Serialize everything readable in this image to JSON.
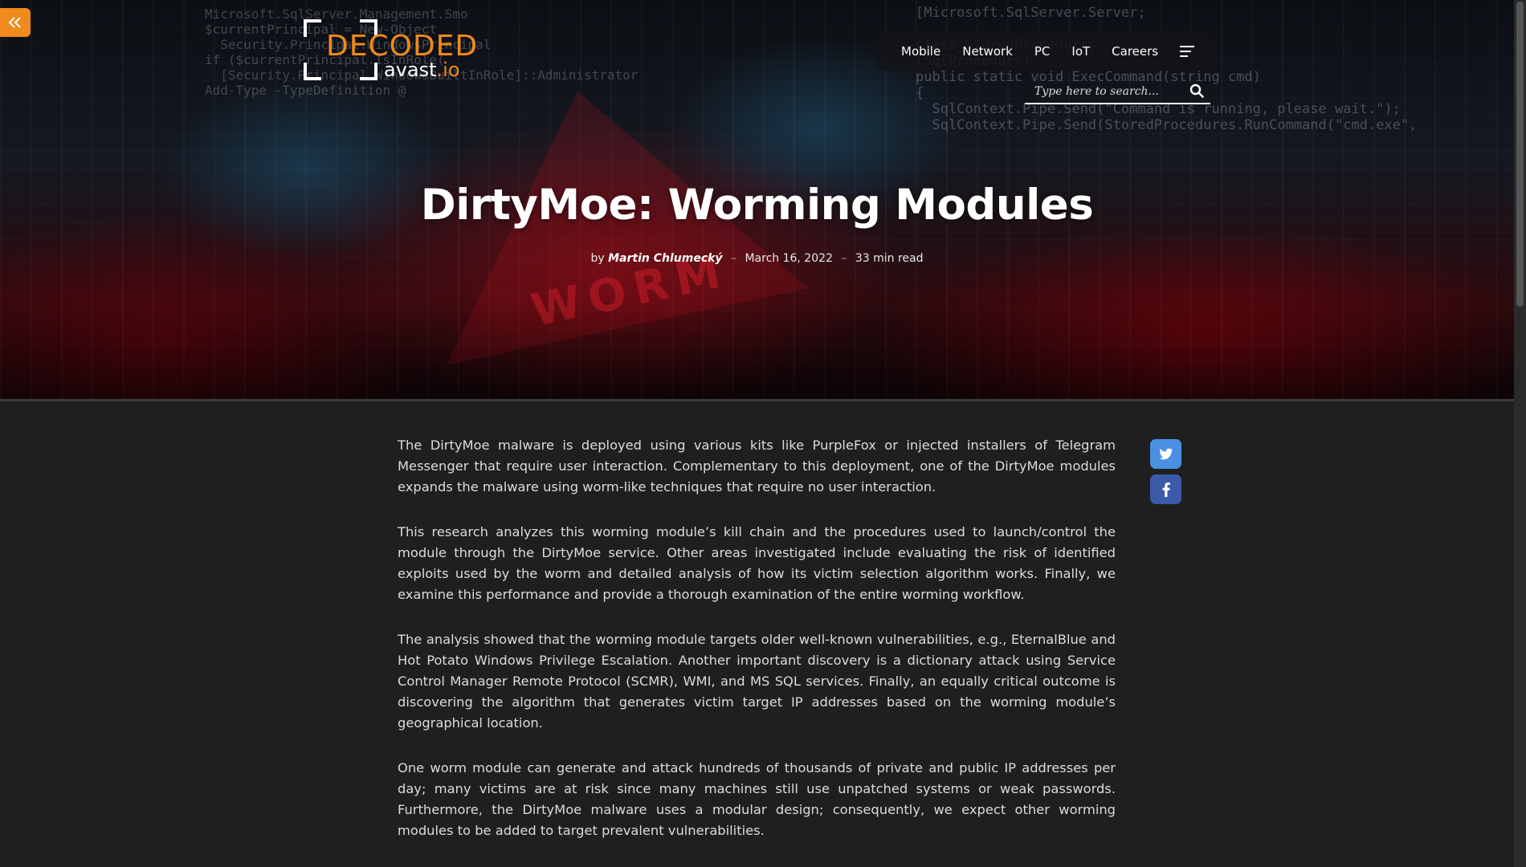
{
  "site": {
    "logo_decoded": "DECODED",
    "logo_avast": "avast",
    "logo_io": ".io"
  },
  "nav": {
    "items": [
      "Mobile",
      "Network",
      "PC",
      "IoT",
      "Careers"
    ],
    "menu_icon": "menu-lines-icon"
  },
  "search": {
    "placeholder": "Type here to search...",
    "icon": "search-icon"
  },
  "article": {
    "title": "DirtyMoe: Worming Modules",
    "by": "by",
    "author": "Martin Chlumecký",
    "date": "March 16, 2022",
    "read_time": "33 min read",
    "paragraphs": [
      "The DirtyMoe malware is deployed using various kits like PurpleFox or injected installers of Telegram Messenger that require user interaction. Complementary to this deployment, one of the DirtyMoe modules expands the malware using worm-like techniques that require no user interaction.",
      "This research analyzes this worming module’s kill chain and the procedures used to launch/control the module through the DirtyMoe service. Other areas investigated include evaluating the risk of identified exploits used by the worm and detailed analysis of how its victim selection algorithm works. Finally, we examine this performance and provide a thorough examination of the entire worming workflow.",
      "The analysis showed that the worming module targets older well-known vulnerabilities, e.g., EternalBlue and Hot Potato Windows Privilege Escalation. Another important discovery is a dictionary attack using Service Control Manager Remote Protocol (SCMR), WMI, and MS SQL services. Finally, an equally critical outcome is discovering the algorithm that generates victim target IP addresses based on the worming module’s geographical location.",
      "One worm module can generate and attack hundreds of thousands of private and public IP addresses per day; many victims are at risk since many machines still use unpatched systems or weak passwords. Furthermore, the DirtyMoe malware uses a modular design; consequently, we expect other worming modules to be added to target prevalent vulnerabilities."
    ]
  },
  "hero_art": {
    "code_lines_left": "Microsoft.SqlServer.Management.Smo\n$currentPrincipal = New-Object\n  Security.Principal.WindowsPrincipal\nif ($currentPrincipal.IsInRole(\n  [Security.Principal.WindowsBuiltInRole]::Administrator\nAdd-Type -TypeDefinition @",
    "code_lines_right": "[Microsoft.SqlServer.Server;\n\nclass StoredProcedures\n[SqlProcedure]\npublic static void ExecCommand(string cmd)\n{\n  SqlContext.Pipe.Send(\"Command is running, please wait.\");\n  SqlContext.Pipe.Send(StoredProcedures.RunCommand(\"cmd.exe\",",
    "worm_text": "WORM"
  },
  "share": {
    "twitter_icon": "twitter-icon",
    "facebook_icon": "facebook-icon"
  },
  "colors": {
    "accent": "#f08a1c",
    "twitter": "#4a90e2",
    "facebook": "#3b5aa8",
    "background": "#1f1f1f"
  }
}
